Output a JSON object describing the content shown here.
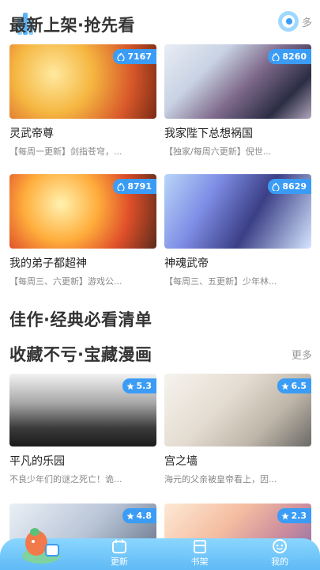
{
  "sections": {
    "new": {
      "title": "最新上架·抢先看",
      "more": "多"
    },
    "classic": {
      "title": "佳作·经典必看清单"
    },
    "treasure": {
      "title": "收藏不亏·宝藏漫画",
      "more": "更多"
    }
  },
  "new_cards": [
    {
      "title": "灵武帝尊",
      "desc": "【每周一更新】剑指苍穹，...",
      "heat": "7167"
    },
    {
      "title": "我家陛下总想祸国",
      "desc": "【独家/每周六更新】倪世...",
      "heat": "8260"
    },
    {
      "title": "我的弟子都超神",
      "desc": "【每周三、六更新】游戏公...",
      "heat": "8791"
    },
    {
      "title": "神魂武帝",
      "desc": "【每周三、五更新】少年林...",
      "heat": "8629"
    }
  ],
  "treasure_cards": [
    {
      "title": "平凡的乐园",
      "desc": "不良少年们的谜之死亡！诡...",
      "rating": "5.3"
    },
    {
      "title": "宫之墙",
      "desc": "海元的父亲被皇帝看上，因...",
      "rating": "6.5"
    },
    {
      "rating": "4.8"
    },
    {
      "rating": "2.3"
    }
  ],
  "nav": {
    "items": [
      {
        "label": "更新",
        "icon": "calendar-icon"
      },
      {
        "label": "书架",
        "icon": "bookshelf-icon"
      },
      {
        "label": "我的",
        "icon": "profile-icon"
      }
    ]
  },
  "colors": {
    "accent": "#3b9cf5",
    "nav_bg": "#6ec6fa"
  }
}
